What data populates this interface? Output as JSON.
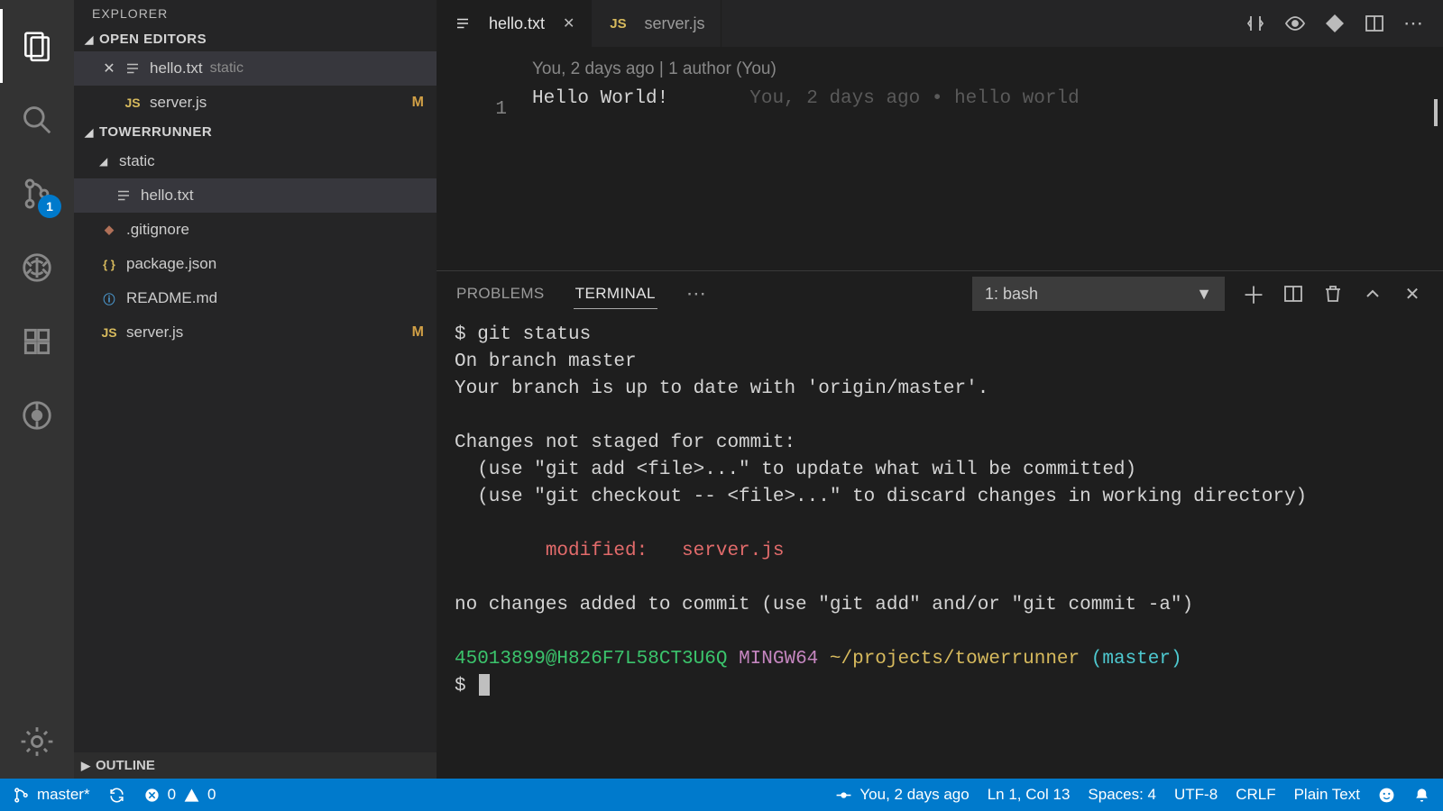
{
  "sidebar": {
    "title": "EXPLORER",
    "openEditorsHeader": "OPEN EDITORS",
    "workspaceHeader": "TOWERRUNNER",
    "outlineHeader": "OUTLINE",
    "scmBadge": "1",
    "openEditors": [
      {
        "icon": "lines",
        "name": "hello.txt",
        "suffix": "static",
        "active": true,
        "hasClose": true
      },
      {
        "icon": "js",
        "name": "server.js",
        "mod": "M"
      }
    ],
    "tree": {
      "folder": "static",
      "folderFile": {
        "icon": "lines",
        "name": "hello.txt",
        "active": true
      },
      "files": [
        {
          "icon": "git",
          "name": ".gitignore"
        },
        {
          "icon": "json",
          "name": "package.json"
        },
        {
          "icon": "info",
          "name": "README.md"
        },
        {
          "icon": "js",
          "name": "server.js",
          "mod": "M"
        }
      ]
    }
  },
  "tabs": [
    {
      "icon": "lines",
      "name": "hello.txt",
      "active": true,
      "closeable": true
    },
    {
      "icon": "js",
      "name": "server.js",
      "active": false
    }
  ],
  "editor": {
    "codelens": "You, 2 days ago | 1 author (You)",
    "lineNumber": "1",
    "lineText": "Hello World!",
    "blame": "You, 2 days ago • hello world"
  },
  "panel": {
    "tabs": {
      "problems": "PROBLEMS",
      "terminal": "TERMINAL"
    },
    "shellLabel": "1: bash",
    "terminal": {
      "l1": "$ git status",
      "l2": "On branch master",
      "l3": "Your branch is up to date with 'origin/master'.",
      "l4": "Changes not staged for commit:",
      "l5": "  (use \"git add <file>...\" to update what will be committed)",
      "l6": "  (use \"git checkout -- <file>...\" to discard changes in working directory)",
      "l7": "        modified:   server.js",
      "l8": "no changes added to commit (use \"git add\" and/or \"git commit -a\")",
      "prompt_user": "45013899@H826F7L58CT3U6Q",
      "prompt_sys": "MINGW64",
      "prompt_path": "~/projects/towerrunner",
      "prompt_branch": "(master)",
      "dollar": "$ "
    }
  },
  "status": {
    "branch": "master*",
    "err": "0",
    "warn": "0",
    "blame": "You, 2 days ago",
    "cursor": "Ln 1, Col 13",
    "spaces": "Spaces: 4",
    "encoding": "UTF-8",
    "eol": "CRLF",
    "lang": "Plain Text"
  }
}
